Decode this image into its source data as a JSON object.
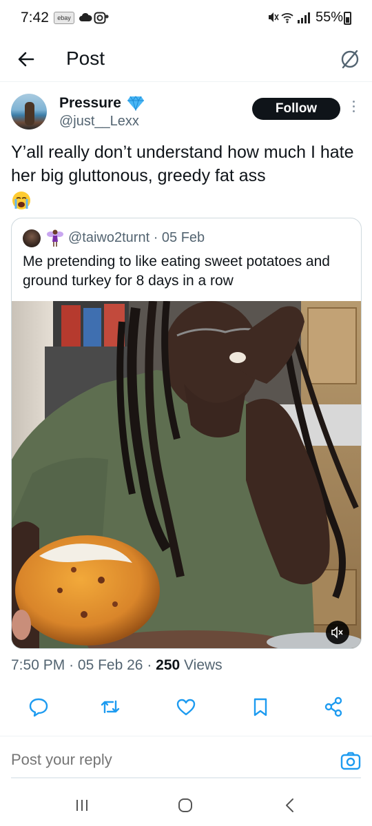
{
  "status_bar": {
    "time": "7:42",
    "ebay_label": "ebay",
    "battery_text": "55%"
  },
  "header": {
    "title": "Post",
    "back_icon": "arrow-left-icon",
    "grok_icon": "grok-slash-icon"
  },
  "post": {
    "author_name": "Pressure",
    "verified_icon": "blue-diamond-icon",
    "author_handle": "@just__Lexx",
    "follow_label": "Follow",
    "text": "Y’all really don’t understand how much I hate her big gluttonous, greedy fat ass",
    "emoji": "loudly-crying-face-icon",
    "time": "7:50 PM",
    "date": "05 Feb 26",
    "views_count": "250",
    "views_label": "Views"
  },
  "quote": {
    "handle": "@taiwo2turnt",
    "date": "05 Feb",
    "handle_line": "@taiwo2turnt · 05 Feb",
    "text": "Me pretending to like eating sweet potatoes and ground turkey for 8 days in a row",
    "media_icon": "video-thumbnail",
    "mute_icon": "muted-speaker-icon"
  },
  "actions": [
    {
      "name": "reply-button",
      "icon": "reply-bubble-icon"
    },
    {
      "name": "repost-button",
      "icon": "repost-icon"
    },
    {
      "name": "like-button",
      "icon": "heart-icon"
    },
    {
      "name": "bookmark-button",
      "icon": "bookmark-icon"
    },
    {
      "name": "share-button",
      "icon": "share-icon"
    }
  ],
  "reply": {
    "placeholder": "Post your reply"
  },
  "colors": {
    "text": "#0f1419",
    "secondary": "#536471",
    "accent": "#1d9bf0",
    "border": "#cfd9de"
  }
}
